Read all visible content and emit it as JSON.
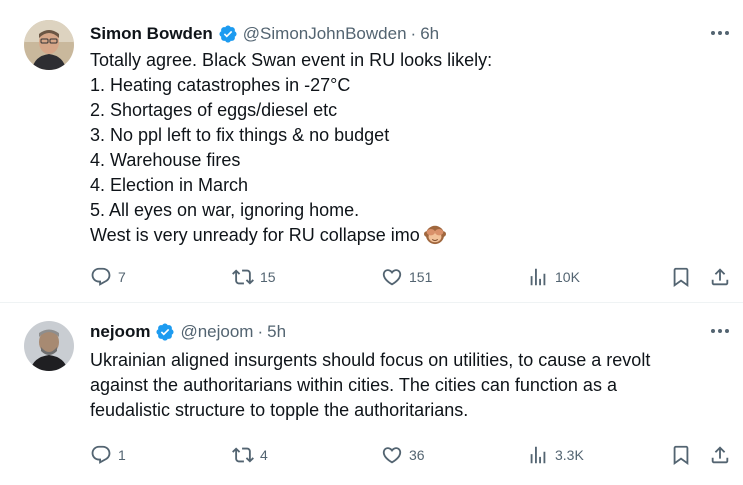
{
  "tweets": [
    {
      "name": "Simon Bowden",
      "handle": "@SimonJohnBowden",
      "dot": "·",
      "time": "6h",
      "lines": [
        "Totally agree. Black Swan event in RU looks likely:",
        "1. Heating catastrophes  in -27°C",
        "2. Shortages of eggs/diesel etc",
        "3. No ppl left to fix things & no budget",
        "4. Warehouse fires",
        "4. Election in March",
        "5. All eyes on war, ignoring home.",
        "West is very unready for RU collapse imo"
      ],
      "emoji": "see-no-evil-monkey",
      "replies": "7",
      "reposts": "15",
      "likes": "151",
      "views": "10K"
    },
    {
      "name": "nejoom",
      "handle": "@nejoom",
      "dot": "·",
      "time": "5h",
      "lines": [
        "Ukrainian aligned insurgents should focus on utilities, to cause a revolt",
        "against the authoritarians within cities. The cities can function as a",
        "feudalistic structure to topple the authoritarians."
      ],
      "replies": "1",
      "reposts": "4",
      "likes": "36",
      "views": "3.3K"
    }
  ],
  "colors": {
    "text": "#0f1419",
    "secondary": "#536471",
    "verified": "#1d9bf0",
    "divider": "#eff3f4"
  }
}
